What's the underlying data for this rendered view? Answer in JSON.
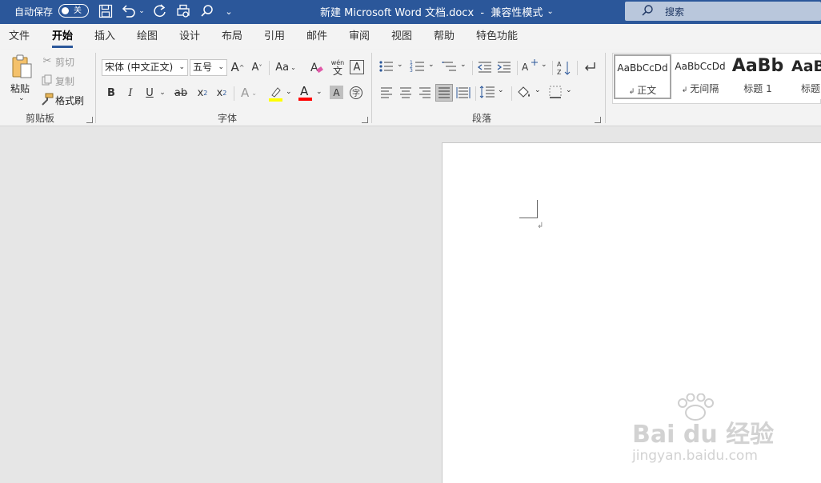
{
  "titlebar": {
    "autosave_label": "自动保存",
    "autosave_state": "关",
    "doc_title": "新建 Microsoft Word 文档.docx  -  兼容性模式",
    "search_label": "搜索"
  },
  "tabs": [
    "文件",
    "开始",
    "插入",
    "绘图",
    "设计",
    "布局",
    "引用",
    "邮件",
    "审阅",
    "视图",
    "帮助",
    "特色功能"
  ],
  "active_tab": "开始",
  "clipboard": {
    "paste_label": "粘贴",
    "cut_label": "剪切",
    "copy_label": "复制",
    "format_painter_label": "格式刷",
    "group_label": "剪贴板"
  },
  "font": {
    "font_name": "宋体 (中文正文)",
    "font_size": "五号",
    "grow_label": "A",
    "shrink_label": "A",
    "case_label": "Aa",
    "phonetic_label": "wén",
    "bold_label": "B",
    "italic_label": "I",
    "underline_label": "U",
    "strike_label": "ab",
    "subscript_label": "x",
    "superscript_label": "x",
    "group_label": "字体",
    "highlight_color": "#ffff00",
    "font_color": "#ff0000"
  },
  "paragraph": {
    "group_label": "段落"
  },
  "styles": {
    "items": [
      {
        "preview": "AaBbCcDd",
        "name": "正文"
      },
      {
        "preview": "AaBbCcDd",
        "name": "无间隔"
      },
      {
        "preview": "AaBb",
        "name": "标题 1"
      },
      {
        "preview": "AaBl",
        "name": "标题"
      }
    ]
  },
  "colors": {
    "titlebar_bg": "#2b579a",
    "ribbon_bg": "#f3f3f3",
    "doc_bg": "#e6e6e6"
  },
  "watermark": {
    "brand": "Bai du 经验",
    "url": "jingyan.baidu.com"
  }
}
